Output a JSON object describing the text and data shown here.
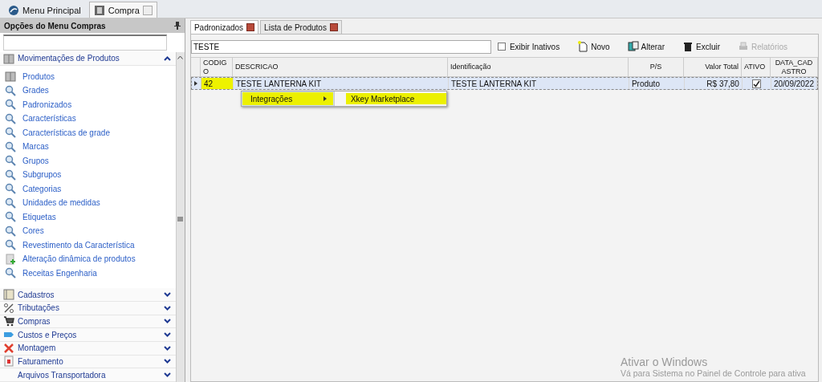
{
  "top_tabs": [
    {
      "label": "Menu Principal",
      "selected": false
    },
    {
      "label": "Compra",
      "selected": true
    }
  ],
  "sidebar": {
    "title": "Opções do Menu Compras",
    "sections": [
      {
        "label": "Movimentações de Produtos",
        "expanded": true,
        "items": [
          {
            "label": "Produtos",
            "kind": "box"
          },
          {
            "label": "Grades",
            "kind": "search"
          },
          {
            "label": "Padronizados",
            "kind": "search"
          },
          {
            "label": "Características",
            "kind": "search"
          },
          {
            "label": "Características de grade",
            "kind": "search"
          },
          {
            "label": "Marcas",
            "kind": "search"
          },
          {
            "label": "Grupos",
            "kind": "search"
          },
          {
            "label": "Subgrupos",
            "kind": "search"
          },
          {
            "label": "Categorias",
            "kind": "search"
          },
          {
            "label": "Unidades de medidas",
            "kind": "search"
          },
          {
            "label": "Etiquetas",
            "kind": "search"
          },
          {
            "label": "Cores",
            "kind": "search"
          },
          {
            "label": "Revestimento da Característica",
            "kind": "search"
          },
          {
            "label": "Alteração dinâmica de produtos",
            "kind": "add"
          },
          {
            "label": "Receitas Engenharia",
            "kind": "search"
          }
        ]
      },
      {
        "label": "Cadastros",
        "expanded": false
      },
      {
        "label": "Tributações",
        "expanded": false
      },
      {
        "label": "Compras",
        "expanded": false
      },
      {
        "label": "Custos e Preços",
        "expanded": false
      },
      {
        "label": "Montagem",
        "expanded": false
      },
      {
        "label": "Faturamento",
        "expanded": false
      },
      {
        "label": "Arquivos Transportadora",
        "expanded": false
      }
    ]
  },
  "inner_tabs": [
    {
      "label": "Padronizados",
      "selected": true
    },
    {
      "label": "Lista de Produtos",
      "selected": false
    }
  ],
  "toolbar": {
    "search": {
      "value": "TESTE"
    },
    "show_inactive": {
      "label": "Exibir Inativos",
      "checked": false
    },
    "buttons": [
      {
        "label": "Novo",
        "disabled": false
      },
      {
        "label": "Alterar",
        "disabled": false
      },
      {
        "label": "Excluir",
        "disabled": false
      },
      {
        "label": "Relatórios",
        "disabled": true
      }
    ]
  },
  "table": {
    "columns": [
      "CODIGO",
      "DESCRICAO",
      "Identificação",
      "P/S",
      "Valor Total",
      "ATIVO",
      "DATA_CADASTRO"
    ],
    "rows": [
      {
        "selected": true,
        "cells": [
          "42",
          "TESTE LANTERNA KIT",
          "TESTE LANTERNA KIT",
          "Produto",
          "R$ 37,80",
          {
            "checked": true
          },
          "20/09/2022"
        ]
      }
    ]
  },
  "context_menu": {
    "items": [
      {
        "label": "Integrações",
        "highlighted": true
      }
    ],
    "submenu": {
      "items": [
        {
          "label": "Xkey Marketplace",
          "highlighted": true
        }
      ]
    }
  },
  "activation_notice": {
    "title": "Ativar o Windows",
    "text": "Vá para Sistema no Painel de Controle para ativa"
  }
}
